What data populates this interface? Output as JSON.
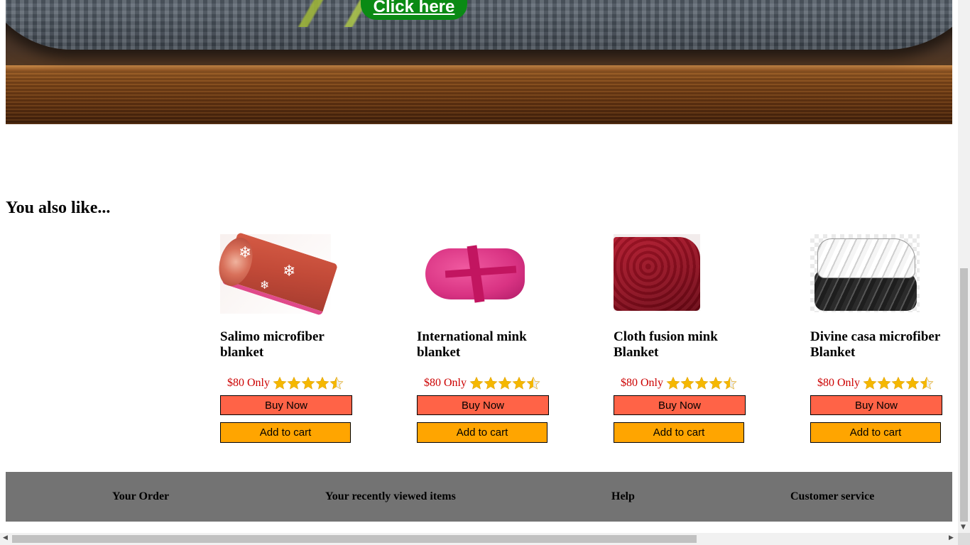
{
  "hero": {
    "button_label": "Click here"
  },
  "section": {
    "title": "You also like..."
  },
  "products": [
    {
      "name": "Salimo microfiber blanket",
      "price": "$80 Only",
      "rating": 4.5,
      "buy_label": "Buy Now",
      "cart_label": "Add to cart"
    },
    {
      "name": "International mink blanket",
      "price": "$80 Only",
      "rating": 4.5,
      "buy_label": "Buy Now",
      "cart_label": "Add to cart"
    },
    {
      "name": "Cloth fusion mink Blanket",
      "price": "$80 Only",
      "rating": 4.5,
      "buy_label": "Buy Now",
      "cart_label": "Add to cart"
    },
    {
      "name": "Divine casa microfiber Blanket",
      "price": "$80 Only",
      "rating": 4.5,
      "buy_label": "Buy Now",
      "cart_label": "Add to cart"
    }
  ],
  "footer": {
    "links": [
      "Your Order",
      "Your recently viewed items",
      "Help",
      "Customer service"
    ]
  },
  "colors": {
    "price": "#cc0000",
    "buy_button": "#ff6347",
    "cart_button": "#ffa500",
    "hero_button": "#0a8a14",
    "footer_bg": "#737373",
    "star": "#f5b800"
  }
}
